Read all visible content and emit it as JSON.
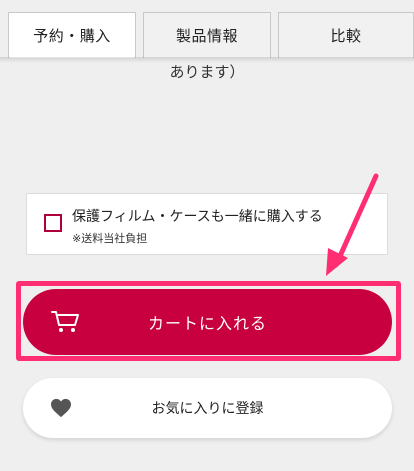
{
  "tabs": [
    {
      "label": "予約・購入",
      "active": true
    },
    {
      "label": "製品情報",
      "active": false
    },
    {
      "label": "比較",
      "active": false
    }
  ],
  "note": {
    "text": "あります）"
  },
  "option": {
    "label": "保護フィルム・ケースも一緒に購入する",
    "sub": "※送料当社負担",
    "checked": false
  },
  "cart_button": {
    "label": "カートに入れる",
    "icon": "cart-icon"
  },
  "favorite_button": {
    "label": "お気に入りに登録",
    "icon": "heart-icon"
  },
  "colors": {
    "accent": "#c8003f",
    "highlight": "#ff2e72",
    "background": "#efefef"
  }
}
